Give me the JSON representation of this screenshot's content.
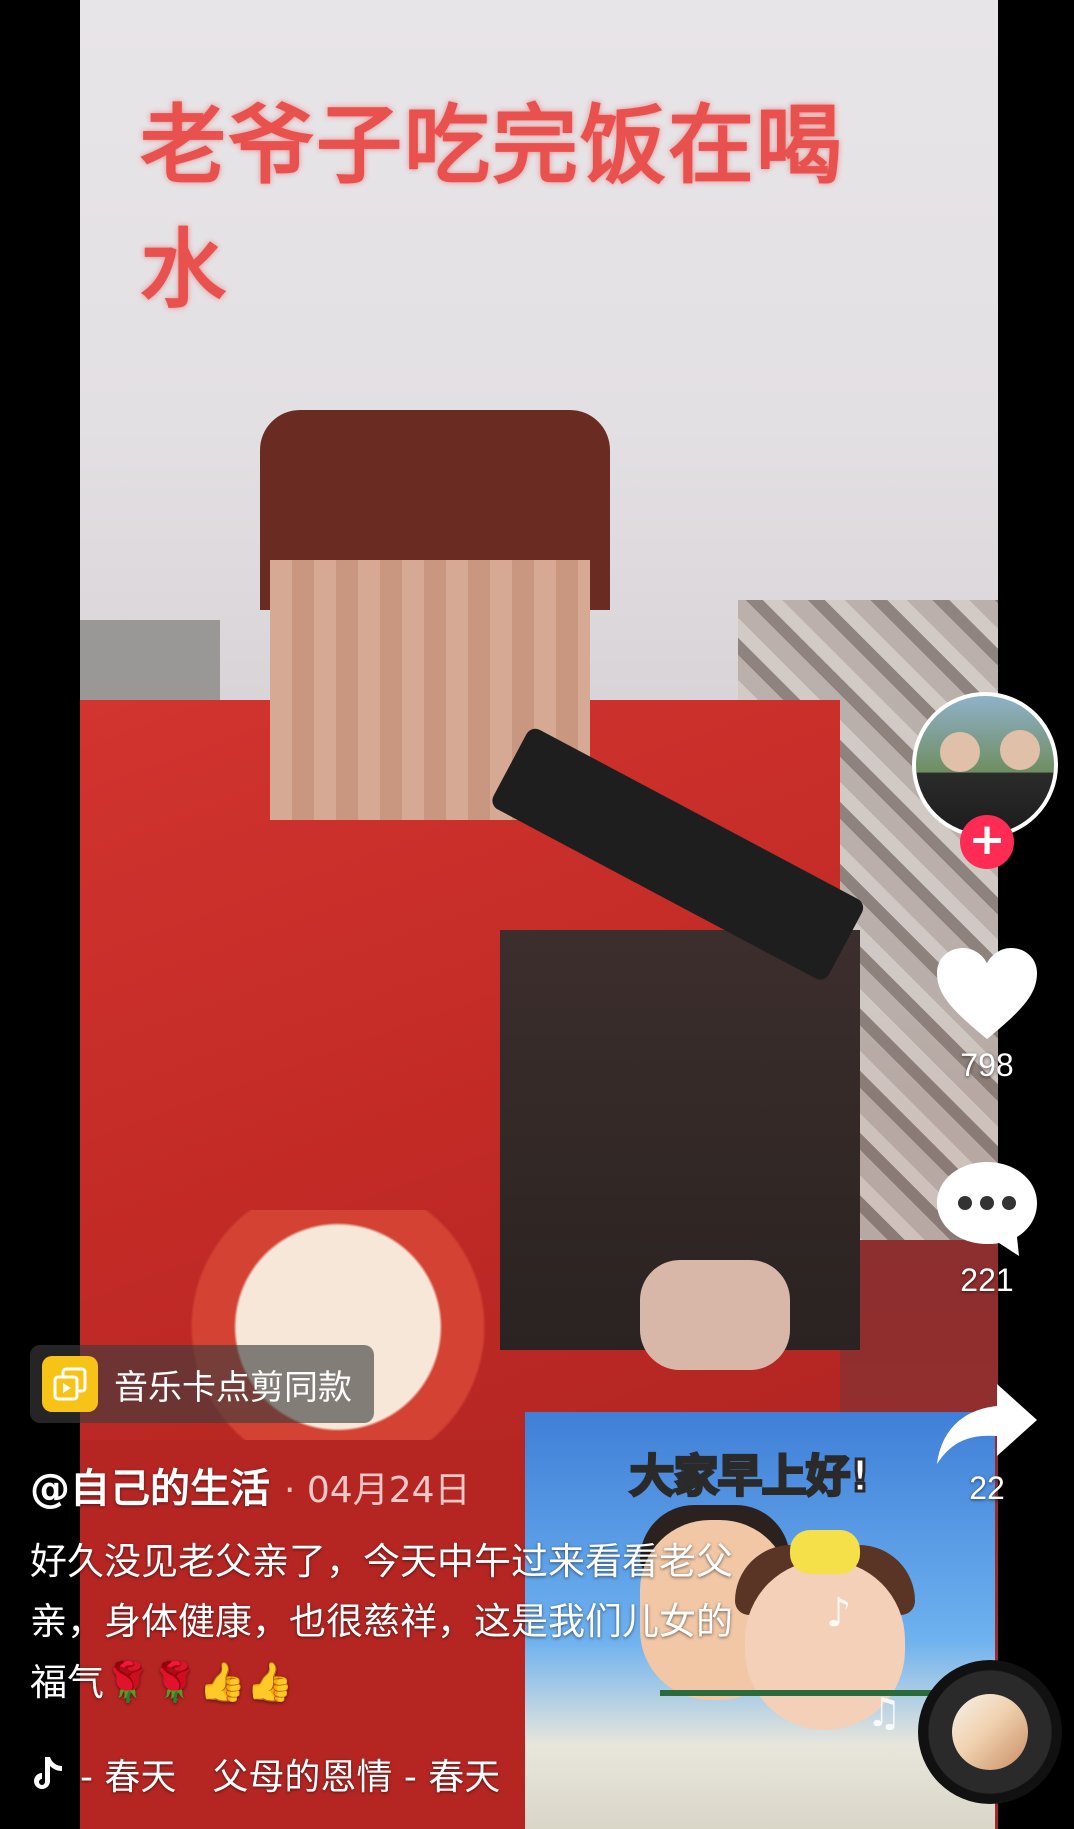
{
  "overlay": {
    "title": "老爷子吃完饭在喝水"
  },
  "inset": {
    "title": "大家早上好!"
  },
  "actions": {
    "likes": "798",
    "comments": "221",
    "shares": "22"
  },
  "follow": {
    "label": "+"
  },
  "template_chip": {
    "label": "音乐卡点剪同款",
    "icon": "template-icon"
  },
  "author": {
    "name": "@自己的生活",
    "date": "· 04月24日"
  },
  "caption": {
    "text": "好久没见老父亲了，今天中午过来看看老父亲，身体健康，也很慈祥，这是我们儿女的福气",
    "emojis": "🌹🌹👍👍"
  },
  "music": {
    "title": "- 春天　父母的恩情 - 春天",
    "icon": "tiktok-note-icon"
  },
  "colors": {
    "accent": "#fe2c55",
    "chip_icon": "#f8c317",
    "overlay_text": "#e8514e"
  }
}
